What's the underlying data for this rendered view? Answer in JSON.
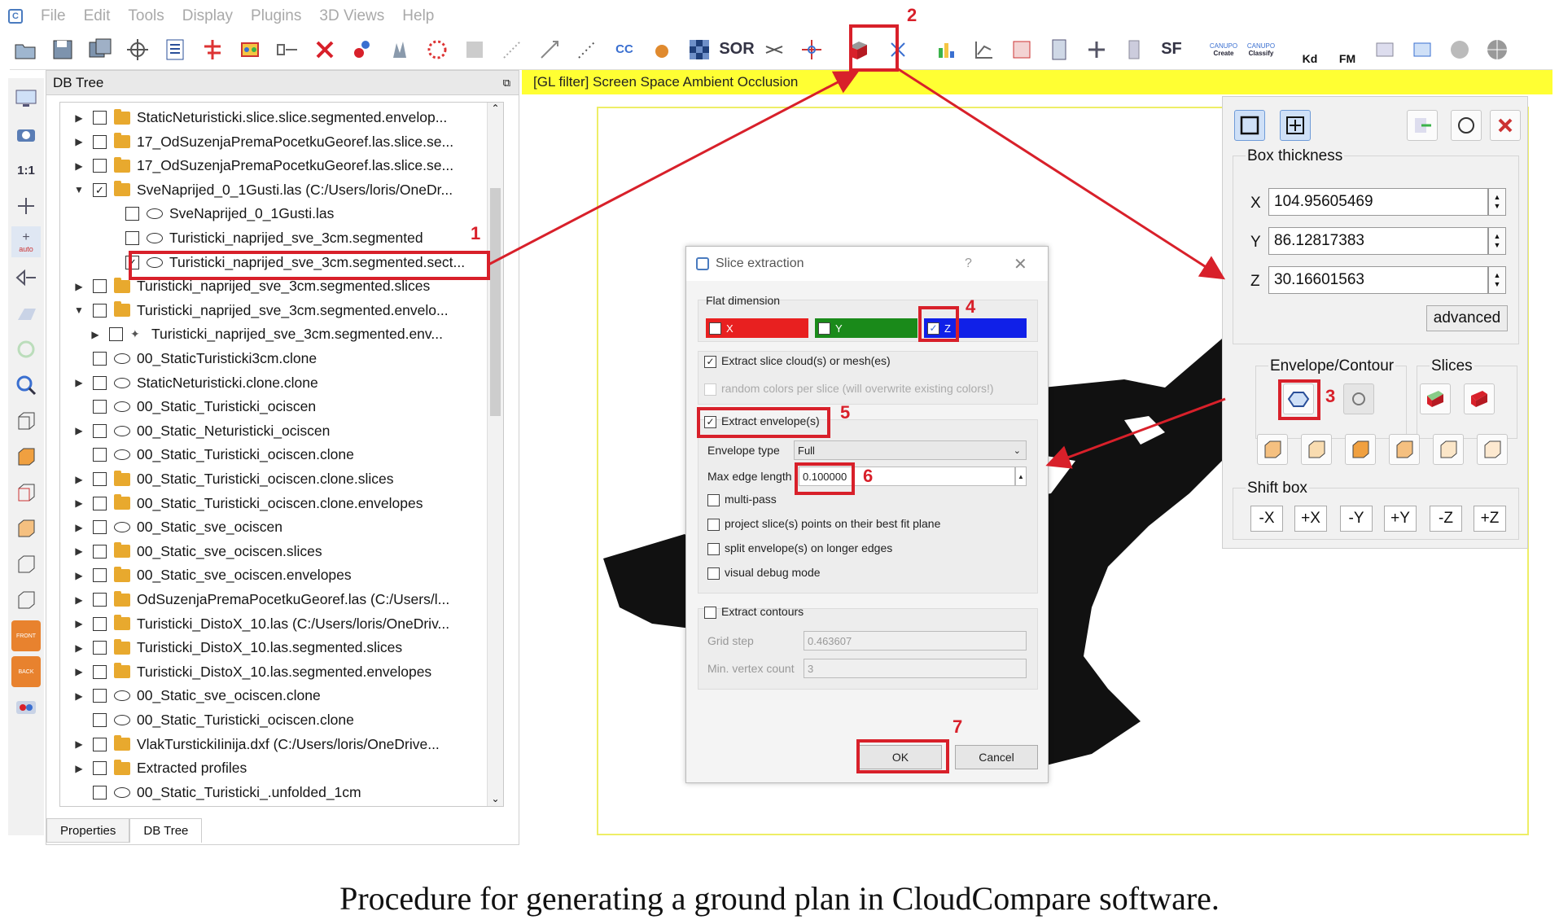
{
  "menubar": {
    "items": [
      "File",
      "Edit",
      "Tools",
      "Display",
      "Plugins",
      "3D Views",
      "Help"
    ]
  },
  "toolbar": {
    "icons": [
      "open-icon",
      "save-icon",
      "save-all-icon",
      "transform-icon",
      "list-icon",
      "crosshair-icon",
      "segment-icon",
      "merge-icon",
      "delete-icon",
      "sample-icon",
      "subsample-icon",
      "noise-icon",
      "grid-icon",
      "scatter-icon",
      "distance-icon",
      "scalar-icon",
      "cc-icon",
      "fill-icon",
      "checker-icon",
      "sor-icon",
      "sf-icon",
      "translate-icon",
      "slice-icon",
      "split-icon",
      "histogram-icon",
      "plot-icon",
      "stat-icon",
      "table-icon",
      "plus-icon",
      "doc-icon",
      "sf-gradient-icon",
      "canupo-create-icon",
      "canupo-classify-icon",
      "kd-icon",
      "fm-icon",
      "ds1-icon",
      "csv-icon",
      "sphere-icon",
      "globe-icon"
    ],
    "sor_label": "SOR",
    "sf_label": "SF",
    "cc_label": "CC",
    "canupo_create": "Create",
    "canupo_classify": "Classify",
    "canupo_top": "CANUPO",
    "kd_label": "Kd",
    "fm_label": "FM"
  },
  "leftstrip": {
    "scale_label": "1:1",
    "auto_label": "auto",
    "front_label": "FRONT",
    "back_label": "BACK"
  },
  "dbtree": {
    "title": "DB Tree",
    "rows": [
      {
        "text": "StaticNeturisticki.slice.slice.segmented.envelop...",
        "kind": "folder",
        "arrow": "right",
        "checked": false
      },
      {
        "text": "17_OdSuzenjaPremaPocetkuGeoref.las.slice.se...",
        "kind": "folder",
        "arrow": "right",
        "checked": false
      },
      {
        "text": "17_OdSuzenjaPremaPocetkuGeoref.las.slice.se...",
        "kind": "folder",
        "arrow": "right",
        "checked": false
      },
      {
        "text": "SveNaprijed_0_1Gusti.las (C:/Users/loris/OneDr...",
        "kind": "folder",
        "arrow": "down",
        "checked": true
      },
      {
        "text": "SveNaprijed_0_1Gusti.las",
        "kind": "cloud",
        "arrow": "",
        "checked": false
      },
      {
        "text": "Turisticki_naprijed_sve_3cm.segmented",
        "kind": "cloud",
        "arrow": "",
        "checked": false
      },
      {
        "text": "Turisticki_naprijed_sve_3cm.segmented.sect...",
        "kind": "cloud",
        "arrow": "",
        "checked": true
      },
      {
        "text": "Turisticki_naprijed_sve_3cm.segmented.slices",
        "kind": "folder",
        "arrow": "right",
        "checked": false
      },
      {
        "text": "Turisticki_naprijed_sve_3cm.segmented.envelo...",
        "kind": "folder",
        "arrow": "down",
        "checked": false
      },
      {
        "text": "Turisticki_naprijed_sve_3cm.segmented.env...",
        "kind": "polyline",
        "arrow": "right",
        "checked": false
      },
      {
        "text": "00_StaticTuristicki3cm.clone",
        "kind": "cloud",
        "arrow": "",
        "checked": false
      },
      {
        "text": "StaticNeturisticki.clone.clone",
        "kind": "cloud",
        "arrow": "right",
        "checked": false
      },
      {
        "text": "00_Static_Turisticki_ociscen",
        "kind": "cloud",
        "arrow": "",
        "checked": false
      },
      {
        "text": "00_Static_Neturisticki_ociscen",
        "kind": "cloud",
        "arrow": "right",
        "checked": false
      },
      {
        "text": "00_Static_Turisticki_ociscen.clone",
        "kind": "cloud",
        "arrow": "",
        "checked": false
      },
      {
        "text": "00_Static_Turisticki_ociscen.clone.slices",
        "kind": "folder",
        "arrow": "right",
        "checked": false
      },
      {
        "text": "00_Static_Turisticki_ociscen.clone.envelopes",
        "kind": "folder",
        "arrow": "right",
        "checked": false
      },
      {
        "text": "00_Static_sve_ociscen",
        "kind": "cloud",
        "arrow": "right",
        "checked": false
      },
      {
        "text": "00_Static_sve_ociscen.slices",
        "kind": "folder",
        "arrow": "right",
        "checked": false
      },
      {
        "text": "00_Static_sve_ociscen.envelopes",
        "kind": "folder",
        "arrow": "right",
        "checked": false
      },
      {
        "text": "OdSuzenjaPremaPocetkuGeoref.las (C:/Users/l...",
        "kind": "folder",
        "arrow": "right",
        "checked": false
      },
      {
        "text": "Turisticki_DistoX_10.las (C:/Users/loris/OneDriv...",
        "kind": "folder",
        "arrow": "right",
        "checked": false
      },
      {
        "text": "Turisticki_DistoX_10.las.segmented.slices",
        "kind": "folder",
        "arrow": "right",
        "checked": false
      },
      {
        "text": "Turisticki_DistoX_10.las.segmented.envelopes",
        "kind": "folder",
        "arrow": "right",
        "checked": false
      },
      {
        "text": "00_Static_sve_ociscen.clone",
        "kind": "cloud",
        "arrow": "right",
        "checked": false
      },
      {
        "text": "00_Static_Turisticki_ociscen.clone",
        "kind": "cloud",
        "arrow": "",
        "checked": false
      },
      {
        "text": "VlakTurstickiІinija.dxf (C:/Users/loris/OneDrive...",
        "kind": "folder",
        "arrow": "right",
        "checked": false
      },
      {
        "text": "Extracted profiles",
        "kind": "folder",
        "arrow": "right",
        "checked": false
      },
      {
        "text": "00_Static_Turisticki_.unfolded_1cm",
        "kind": "cloud",
        "arrow": "",
        "checked": false
      }
    ],
    "tabs": [
      "Properties",
      "DB Tree"
    ]
  },
  "viewport": {
    "filter_text": "[GL filter] Screen Space Ambient Occlusion"
  },
  "slice_dialog": {
    "title": "Slice extraction",
    "help": "?",
    "flat_dimension_label": "Flat dimension",
    "dims": [
      "X",
      "Y",
      "Z"
    ],
    "extract_slices": "Extract slice cloud(s) or mesh(es)",
    "random_colors": "random colors per slice (will overwrite existing colors!)",
    "extract_envelopes": "Extract envelope(s)",
    "envelope_type_label": "Envelope type",
    "envelope_type_value": "Full",
    "max_edge_label": "Max edge length",
    "max_edge_value": "0.100000",
    "multipass": "multi-pass",
    "project_slices": "project slice(s) points on their best fit plane",
    "split_envelopes": "split envelope(s) on longer edges",
    "visual_debug": "visual debug mode",
    "extract_contours": "Extract contours",
    "grid_step_label": "Grid step",
    "grid_step_value": "0.463607",
    "min_vertex_label": "Min. vertex count",
    "min_vertex_value": "3",
    "ok": "OK",
    "cancel": "Cancel"
  },
  "section_panel": {
    "box_thickness_label": "Box thickness",
    "x_label": "X",
    "x_value": "104.95605469",
    "y_label": "Y",
    "y_value": "86.12817383",
    "z_label": "Z",
    "z_value": "30.16601563",
    "advanced": "advanced",
    "envelope_label": "Envelope/Contour",
    "slices_label": "Slices",
    "shift_label": "Shift box",
    "shift_buttons": [
      "-X",
      "+X",
      "-Y",
      "+Y",
      "-Z",
      "+Z"
    ]
  },
  "annotations": [
    "1",
    "2",
    "3",
    "4",
    "5",
    "6",
    "7"
  ],
  "colors": {
    "accent_red": "#d8202a",
    "highlight_yellow": "#ffff33",
    "folder": "#e8a92e"
  },
  "caption": "Procedure for generating a ground plan in CloudCompare software."
}
